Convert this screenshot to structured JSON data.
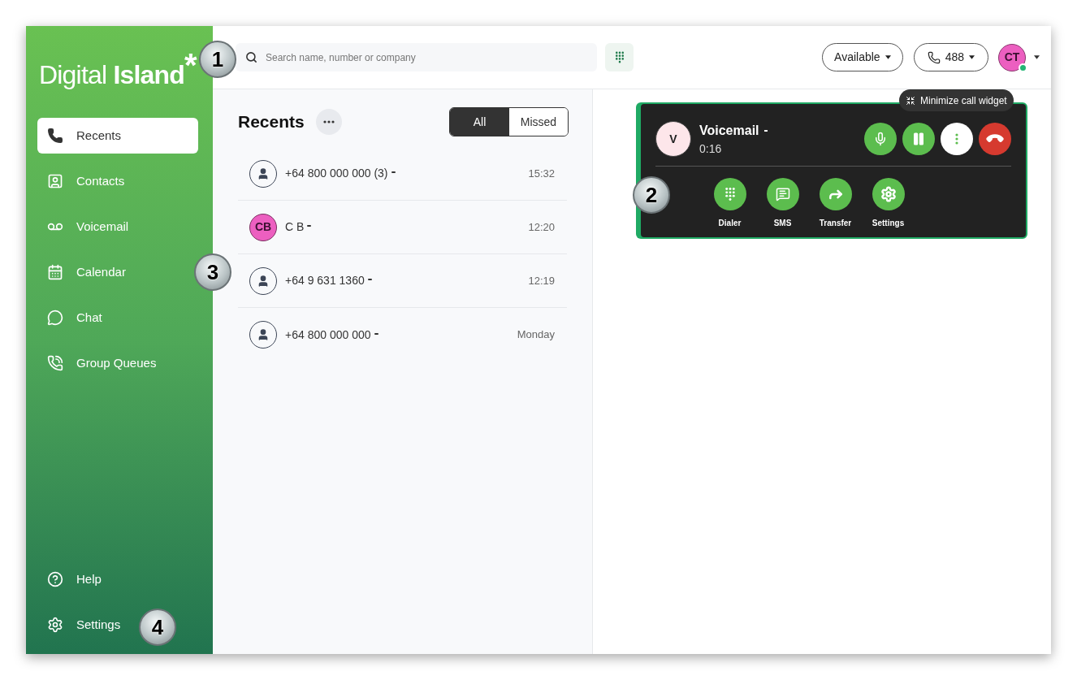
{
  "logo": {
    "light": "Digital",
    "bold": "Island",
    "mark": "*"
  },
  "sidebar": {
    "items": [
      {
        "label": "Recents",
        "kind": "phone",
        "selected": true
      },
      {
        "label": "Contacts",
        "kind": "contact",
        "selected": false
      },
      {
        "label": "Voicemail",
        "kind": "voicemail",
        "selected": false
      },
      {
        "label": "Calendar",
        "kind": "calendar",
        "selected": false
      },
      {
        "label": "Chat",
        "kind": "chat",
        "selected": false
      },
      {
        "label": "Group Queues",
        "kind": "queues",
        "selected": false
      }
    ],
    "footer_items": [
      {
        "label": "Help",
        "kind": "help",
        "selected": false
      },
      {
        "label": "Settings",
        "kind": "settings",
        "selected": false
      }
    ]
  },
  "search": {
    "placeholder": "Search name, number or company"
  },
  "status": {
    "label": "Available"
  },
  "line": {
    "label": "488"
  },
  "user": {
    "initials": "CT",
    "online": true
  },
  "recents": {
    "title": "Recents",
    "filters": [
      {
        "label": "All",
        "selected": true
      },
      {
        "label": "Missed",
        "selected": false
      }
    ],
    "rows": [
      {
        "name": "+64 800 000 000 (3)",
        "time": "15:32",
        "avatar": {
          "kind": "person"
        }
      },
      {
        "name": "C B",
        "time": "12:20",
        "avatar": {
          "kind": "initials",
          "initials": "CB"
        }
      },
      {
        "name": "+64 9 631 1360",
        "time": "12:19",
        "avatar": {
          "kind": "person"
        }
      },
      {
        "name": "+64 800 000 000",
        "time": "Monday",
        "avatar": {
          "kind": "person"
        }
      }
    ]
  },
  "call_widget": {
    "initials": "V",
    "name": "Voicemail",
    "duration": "0:16",
    "tooltip": "Minimize call widget",
    "controls": [
      {
        "kind": "mute"
      },
      {
        "kind": "hold"
      },
      {
        "kind": "more"
      },
      {
        "kind": "hangup"
      }
    ],
    "actions": [
      {
        "label": "Dialer",
        "kind": "dialer"
      },
      {
        "label": "SMS",
        "kind": "sms"
      },
      {
        "label": "Transfer",
        "kind": "transfer"
      },
      {
        "label": "Settings",
        "kind": "settings"
      }
    ]
  },
  "callouts": [
    "1",
    "2",
    "3",
    "4"
  ]
}
